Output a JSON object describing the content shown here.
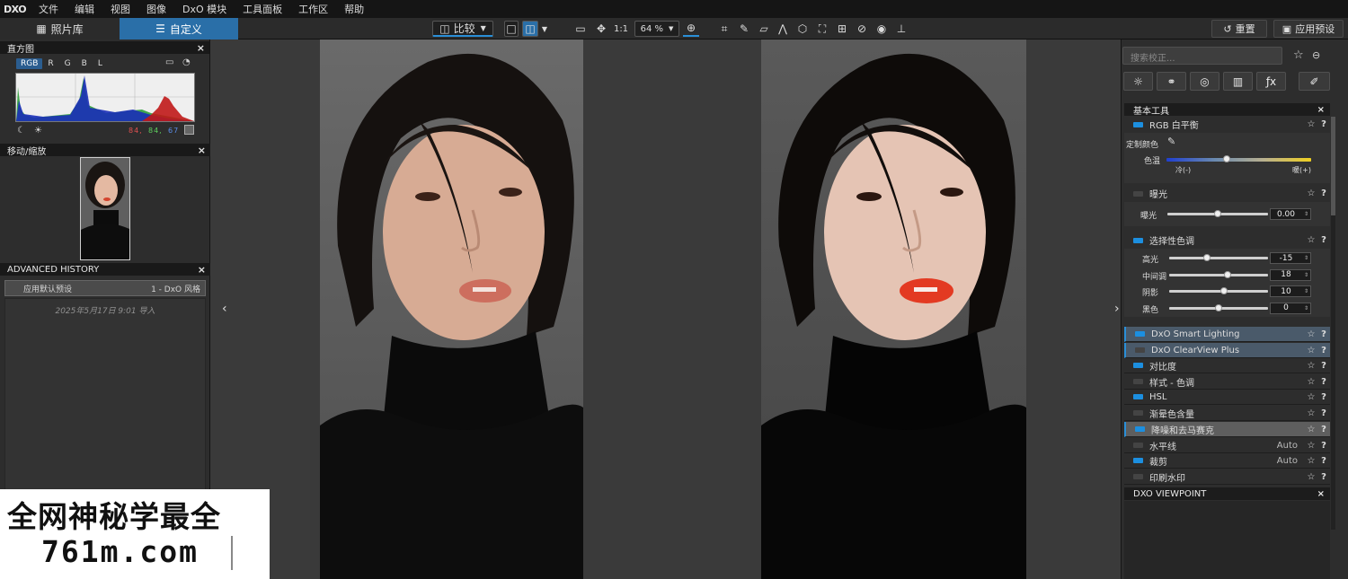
{
  "menubar": {
    "logo": "DXO",
    "items": [
      "文件",
      "编辑",
      "视图",
      "图像",
      "DxO 模块",
      "工具面板",
      "工作区",
      "帮助"
    ]
  },
  "toolbar": {
    "tab_library": "照片库",
    "tab_custom": "自定义",
    "compare": "比较",
    "zoom_1to1": "1:1",
    "zoom": "64 %",
    "reset_label": "重置",
    "apply_preset_label": "应用预设"
  },
  "left": {
    "histogram": {
      "title": "直方图",
      "channels": [
        "RGB",
        "R",
        "G",
        "B",
        "L"
      ],
      "values": [
        "84,",
        "84,",
        "67"
      ]
    },
    "navigator_title": "移动/缩放",
    "history": {
      "title": "ADVANCED HISTORY",
      "row_label": "应用默认预设",
      "row_value": "1 - DxO 风格",
      "entry": "2025年5月17日 9:01 导入"
    }
  },
  "right": {
    "search_placeholder": "搜索校正...",
    "section_title": "基本工具",
    "white_balance": {
      "label": "RGB 白平衡",
      "picker_label": "定制颜色",
      "temp_label": "色温",
      "cold": "冷(-)",
      "warm": "暖(+)"
    },
    "exposure": {
      "label": "曝光",
      "slider_label": "曝光",
      "value": "0.00"
    },
    "tones": {
      "label": "选择性色调",
      "rows": [
        {
          "label": "高光",
          "value": "-15",
          "pos": 0.38
        },
        {
          "label": "中间调",
          "value": "18",
          "pos": 0.59
        },
        {
          "label": "阴影",
          "value": "10",
          "pos": 0.55
        },
        {
          "label": "黑色",
          "value": "0",
          "pos": 0.5
        }
      ]
    },
    "modules": [
      {
        "label": "DxO Smart Lighting",
        "on": true,
        "auto": ""
      },
      {
        "label": "DxO ClearView Plus",
        "on": false,
        "auto": ""
      },
      {
        "label": "对比度",
        "on": true,
        "auto": ""
      },
      {
        "label": "样式 - 色调",
        "on": false,
        "auto": ""
      },
      {
        "label": "HSL",
        "on": true,
        "auto": ""
      },
      {
        "label": "渐晕色含量",
        "on": false,
        "auto": ""
      },
      {
        "label": "降噪和去马赛克",
        "on": true,
        "auto": ""
      },
      {
        "label": "水平线",
        "on": false,
        "auto": "Auto"
      },
      {
        "label": "裁剪",
        "on": true,
        "auto": "Auto"
      },
      {
        "label": "印刷水印",
        "on": false,
        "auto": ""
      }
    ],
    "viewpoint_title": "DXO VIEWPOINT"
  },
  "watermark": {
    "line1": "全网神秘学最全",
    "line2": "761m.com"
  },
  "colors": {
    "accent": "#2a6fa8",
    "switch_on": "#1c8fe0"
  }
}
